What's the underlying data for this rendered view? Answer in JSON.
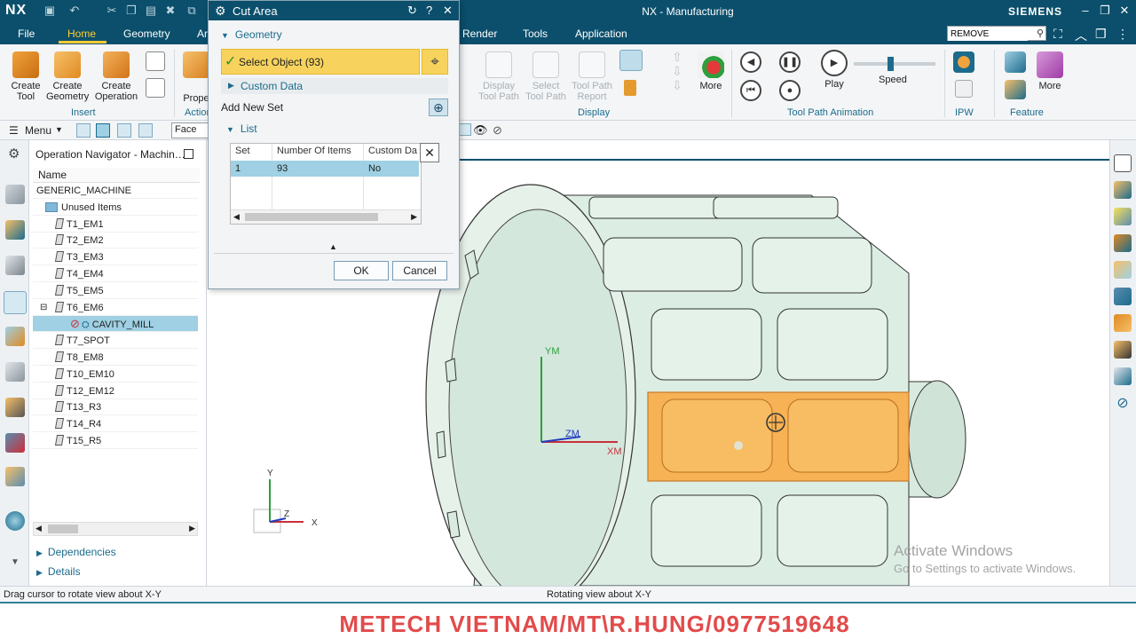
{
  "titlebar": {
    "logo": "NX",
    "app_title": "NX - Manufacturing",
    "brand": "SIEMENS",
    "win_min": "–",
    "win_restore": "❐",
    "win_close": "✕"
  },
  "menubar": {
    "items": [
      "File",
      "Home",
      "Geometry",
      "Ar",
      "Render",
      "Tools",
      "Application"
    ],
    "active": "Home",
    "search_value": "REMOVE"
  },
  "ribbon": {
    "insert_buttons": [
      "Create\nTool",
      "Create\nGeometry",
      "Create\nOperation"
    ],
    "insert_group": "Insert",
    "actions_button": "Prope",
    "actions_group": "Action",
    "display_buttons": [
      "Display\nTool Path",
      "Select\nTool Path",
      "Tool Path\nReport"
    ],
    "display_more": "More",
    "display_group": "Display",
    "play_label": "Play",
    "speed_label": "Speed",
    "speed_level": 0.45,
    "animation_group": "Tool Path Animation",
    "ipw_group": "IPW",
    "feature_more": "More",
    "feature_group": "Feature"
  },
  "toolbar2": {
    "menu_label": "Menu",
    "filter_value": "Face"
  },
  "navigator": {
    "title": "Operation Navigator - Machin…",
    "column": "Name",
    "root": "GENERIC_MACHINE",
    "unused": "Unused Items",
    "tools": [
      "T1_EM1",
      "T2_EM2",
      "T3_EM3",
      "T4_EM4",
      "T5_EM5",
      "T6_EM6"
    ],
    "operation": "CAVITY_MILL",
    "tools_after": [
      "T7_SPOT",
      "T8_EM8",
      "T10_EM10",
      "T12_EM12",
      "T13_R3",
      "T14_R4",
      "T15_R5"
    ],
    "sections": [
      "Dependencies",
      "Details"
    ]
  },
  "dialog": {
    "title": "Cut Area",
    "geometry": "Geometry",
    "select_object": "Select Object (93)",
    "custom_data": "Custom Data",
    "add_new_set": "Add New Set",
    "list": "List",
    "columns": [
      "Set",
      "Number Of Items",
      "Custom Da"
    ],
    "row": [
      "1",
      "93",
      "No"
    ],
    "ok": "OK",
    "cancel": "Cancel"
  },
  "viewport": {
    "wcs_labels": [
      "YM",
      "ZM",
      "XM"
    ],
    "triad_labels": [
      "Y",
      "Z",
      "X"
    ]
  },
  "status": {
    "left": "Drag cursor to rotate view about X-Y",
    "center": "Rotating view about X-Y"
  },
  "watermark": {
    "activate_title": "Activate Windows",
    "activate_sub": "Go to Settings to activate Windows.",
    "banner": "METECH VIETNAM/MT\\R.HUNG/0977519648"
  },
  "colors": {
    "titlebar": "#0b4f6c",
    "accent": "#ffcc33",
    "selection": "#9fd0e3",
    "highlight": "#f7d35d",
    "part": "#d9ebe1",
    "selected_face": "#f6b255",
    "banner_text": "#e24b4b"
  }
}
